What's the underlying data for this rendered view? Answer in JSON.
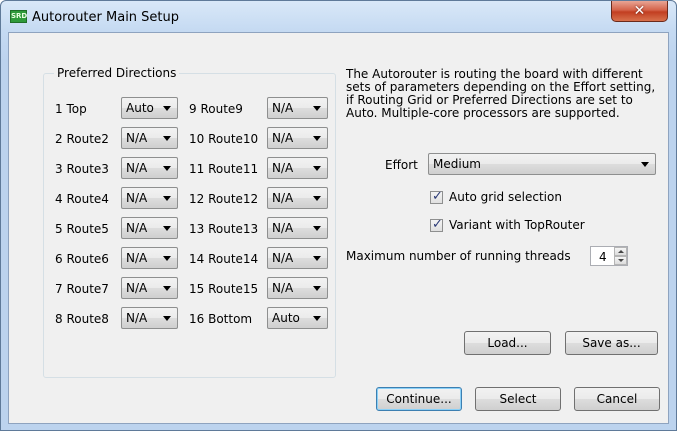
{
  "window": {
    "title": "Autorouter Main Setup",
    "icon_text": "SRD",
    "close_glyph": "✕"
  },
  "preferred_directions": {
    "title": "Preferred Directions",
    "left": [
      {
        "layer": "1 Top",
        "value": "Auto"
      },
      {
        "layer": "2 Route2",
        "value": "N/A"
      },
      {
        "layer": "3 Route3",
        "value": "N/A"
      },
      {
        "layer": "4 Route4",
        "value": "N/A"
      },
      {
        "layer": "5 Route5",
        "value": "N/A"
      },
      {
        "layer": "6 Route6",
        "value": "N/A"
      },
      {
        "layer": "7 Route7",
        "value": "N/A"
      },
      {
        "layer": "8 Route8",
        "value": "N/A"
      }
    ],
    "right": [
      {
        "layer": "9 Route9",
        "value": "N/A"
      },
      {
        "layer": "10 Route10",
        "value": "N/A"
      },
      {
        "layer": "11 Route11",
        "value": "N/A"
      },
      {
        "layer": "12 Route12",
        "value": "N/A"
      },
      {
        "layer": "13 Route13",
        "value": "N/A"
      },
      {
        "layer": "14 Route14",
        "value": "N/A"
      },
      {
        "layer": "15 Route15",
        "value": "N/A"
      },
      {
        "layer": "16 Bottom",
        "value": "Auto"
      }
    ]
  },
  "description": "The Autorouter is routing the board with different sets of parameters depending on the Effort setting, if Routing Grid or Preferred Directions are set to Auto. Multiple-core processors are supported.",
  "effort": {
    "label": "Effort",
    "value": "Medium"
  },
  "auto_grid": {
    "label": "Auto grid selection",
    "checked": true
  },
  "variant_toprouter": {
    "label": "Variant with TopRouter",
    "checked": true
  },
  "threads": {
    "label": "Maximum number of running threads",
    "value": "4"
  },
  "buttons": {
    "load": "Load...",
    "save_as": "Save as...",
    "continue": "Continue...",
    "select": "Select",
    "cancel": "Cancel"
  }
}
